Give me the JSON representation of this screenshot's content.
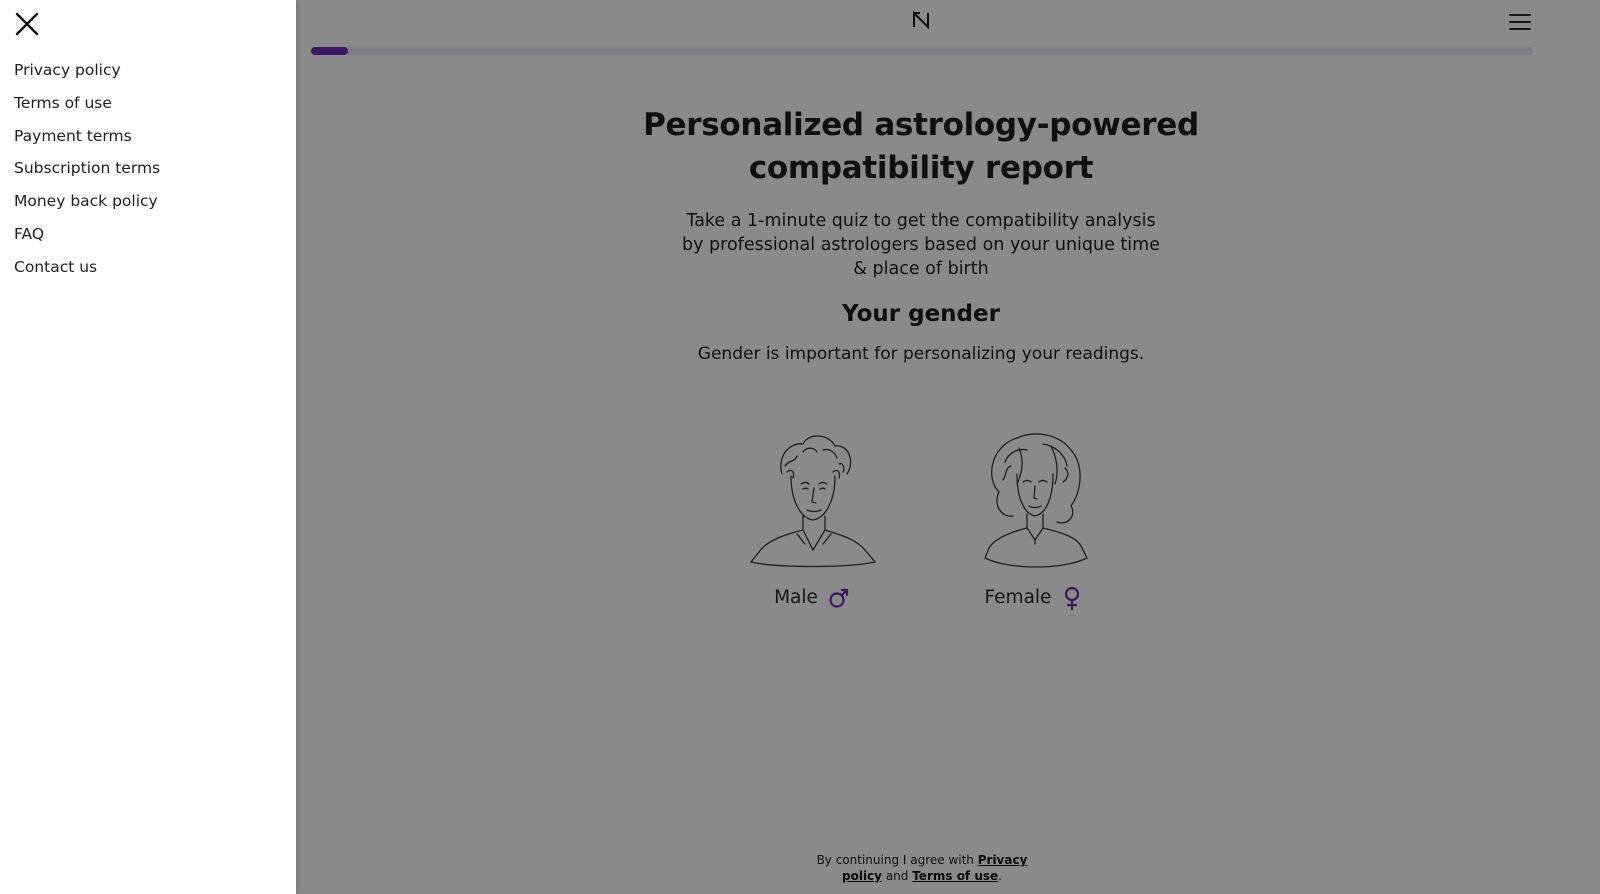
{
  "header": {
    "logo_icon": "brand-logo-icon",
    "menu_icon": "hamburger-menu-icon",
    "accent_color": "#6b2fb3"
  },
  "progress": {
    "value_percent": 3
  },
  "hero": {
    "title": "Personalized astrology-powered compatibility report",
    "subtitle": "Take a 1-minute quiz to get the compatibility analysis by professional astrologers based on your unique time & place of birth"
  },
  "question": {
    "title": "Your gender",
    "description": "Gender is important for personalizing your readings."
  },
  "options": [
    {
      "label": "Male",
      "icon": "male-symbol-icon"
    },
    {
      "label": "Female",
      "icon": "female-symbol-icon"
    }
  ],
  "footer": {
    "prefix": "By continuing I agree with ",
    "privacy_link": "Privacy policy",
    "conjunction": " and ",
    "terms_link": "Terms of use",
    "suffix": "."
  },
  "drawer": {
    "close_icon": "close-icon",
    "items": [
      {
        "label": "Privacy policy"
      },
      {
        "label": "Terms of use"
      },
      {
        "label": "Payment terms"
      },
      {
        "label": "Subscription terms"
      },
      {
        "label": "Money back policy"
      },
      {
        "label": "FAQ"
      },
      {
        "label": "Contact us"
      }
    ]
  }
}
